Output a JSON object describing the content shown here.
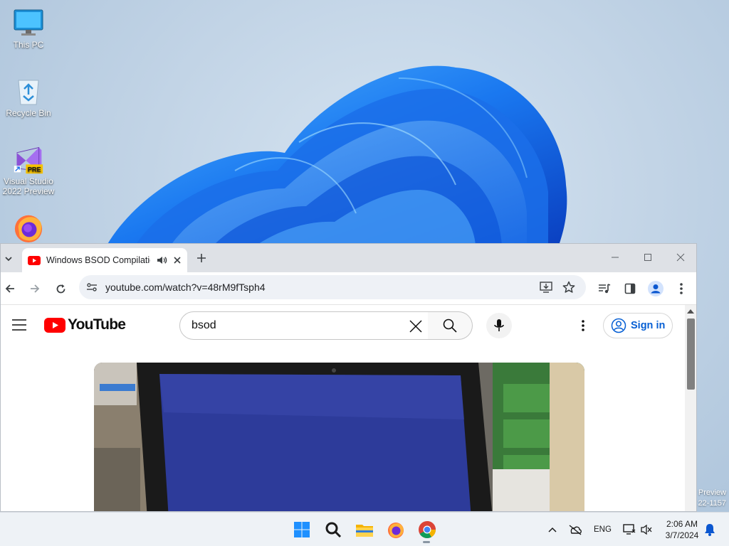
{
  "desktop": {
    "icons": [
      {
        "label": "This PC",
        "icon": "monitor-icon"
      },
      {
        "label": "Recycle Bin",
        "icon": "recycle-bin-icon"
      },
      {
        "label": "Visual Studio 2022 Preview",
        "icon": "visual-studio-icon",
        "badge": "PRE"
      },
      {
        "label": "Firefox",
        "icon": "firefox-icon"
      }
    ],
    "watermark": {
      "line1": "Preview",
      "line2": "22-1157"
    }
  },
  "browser": {
    "tab": {
      "title": "Windows BSOD Compilation",
      "favicon": "youtube-favicon-icon",
      "audio_icon": "speaker-icon"
    },
    "address": {
      "url": "youtube.com/watch?v=48rM9fTsph4"
    },
    "window_controls": [
      "minimize-icon",
      "maximize-icon",
      "close-icon"
    ]
  },
  "youtube": {
    "logo_text": "YouTube",
    "search": {
      "value": "bsod"
    },
    "signin_label": "Sign in"
  },
  "taskbar": {
    "apps": [
      "start-icon",
      "search-icon",
      "file-explorer-icon",
      "firefox-icon",
      "chrome-icon"
    ],
    "tray": {
      "language": "ENG"
    },
    "clock": {
      "time": "2:06 AM",
      "date": "3/7/2024"
    }
  },
  "colors": {
    "youtube_red": "#ff0000",
    "link_blue": "#065fd4",
    "wallpaper_blue": "#0a62e6"
  }
}
